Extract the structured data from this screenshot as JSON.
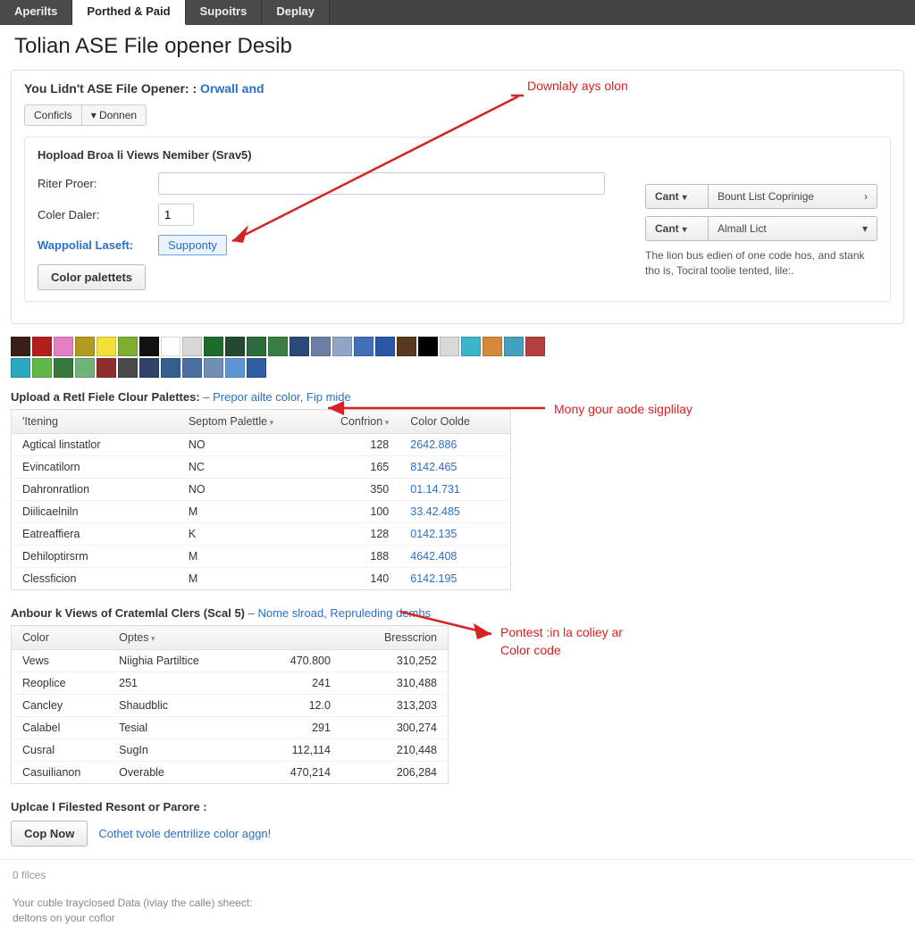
{
  "topnav": {
    "tabs": [
      "Aperilts",
      "Porthed & Paid",
      "Supoitrs",
      "Deplay"
    ],
    "active_index": 1
  },
  "page_title": "Tolian ASE File opener Desib",
  "panel1": {
    "title_prefix": "You Lidn't ASE File Opener: :",
    "title_link": "Orwall and",
    "subtabs": [
      "Conficls",
      "▾ Donnen"
    ],
    "sub_title": "Hopload Broa li Views Nemiber (Srav5)",
    "row_riter": {
      "label": "Riter Proer:",
      "value": ""
    },
    "row_coler": {
      "label": "Coler Daler:",
      "value": "1"
    },
    "row_link": {
      "label": "Wappolial Laseft:",
      "token": "Supponty"
    },
    "main_btn": "Color palettets",
    "right": {
      "pair1": {
        "left": "Cant",
        "right": "Bount List Coprinige"
      },
      "pair2": {
        "left": "Cant",
        "right": "Almall Lict"
      },
      "desc": "The lion bus edien of one code hos, and stank tho is, Tociral toolie tented, lile:."
    }
  },
  "swatches": [
    "#3b1f1a",
    "#b2201c",
    "#e381c0",
    "#b19b1c",
    "#f3e13a",
    "#7fae2f",
    "#111",
    "#fff",
    "#d8d8d8",
    "#1b6d2b",
    "#234a2f",
    "#2d6a3e",
    "#3a7d45",
    "#2b4a7a",
    "#6a7ea6",
    "#8fa6c9",
    "#4270b7",
    "#2a56a5",
    "#5a3a1d",
    "#000",
    "#d9d9d9",
    "#3bb6c9",
    "#d48a38",
    "#45a0bf",
    "#b34040",
    "#2aa8c0",
    "#5fb846",
    "#357a3c",
    "#6fb37a",
    "#8e2f2f",
    "#4a4a4a",
    "#2f446b",
    "#355d8f",
    "#4a6fa3",
    "#6f8fb8",
    "#5c97d4",
    "#2f5fa0"
  ],
  "section2": {
    "title": "Upload a Retl Fiele Clour Palettes:",
    "link": "– Prepor ailte color, Fip mide",
    "headers": [
      "'Itening",
      "Septom Palettle",
      "Confrion",
      "Color Oolde"
    ],
    "rows": [
      [
        "Agtical linstatlor",
        "NO",
        "128",
        "2642.886"
      ],
      [
        "Evincatilorn",
        "NC",
        "165",
        "8142.465"
      ],
      [
        "Dahronratlion",
        "NO",
        "350",
        "01.14.731"
      ],
      [
        "Diilicaelniln",
        "M",
        "100",
        "33.42.485"
      ],
      [
        "Eatreaffiera",
        "K",
        "128",
        "0142.135"
      ],
      [
        "Dehiloptirsrm",
        "M",
        "188",
        "4642.408"
      ],
      [
        "Clessficion",
        "M",
        "140",
        "6142.195"
      ]
    ]
  },
  "section3": {
    "title": "Anbour k Views of Cratemlal Clers (Scal 5)",
    "link": "– Nome slroad, Repruleding demhs",
    "headers": [
      "Color",
      "Optes",
      "",
      "Bresscrion"
    ],
    "rows": [
      [
        "Vews",
        "Niighia Partiltice",
        "470.800",
        "310,252"
      ],
      [
        "Reoplice",
        "251",
        "241",
        "310,488"
      ],
      [
        "Cancley",
        "Shaudblic",
        "12.0",
        "313,203"
      ],
      [
        "Calabel",
        "Tesial",
        "291",
        "300,274"
      ],
      [
        "Cusral",
        "SugIn",
        "112,114",
        "210,448"
      ],
      [
        "Casuilianon",
        "Overable",
        "470,214",
        "206,284"
      ]
    ]
  },
  "bottom": {
    "label": "Uplcae l Filested Resont or Parore :",
    "btn": "Cop Now",
    "bluetext": "Cothet tvole dentrilize color aggn!"
  },
  "footer": "0 filces",
  "footnote1": "Your cuble trayclosed Data (iviay the calle) sheect:",
  "footnote2": "deltons on your coflor",
  "annotations": {
    "a1": "Downlaly ays olon",
    "a2": "Mony gour aode sigplilay",
    "a3a": "Pontest :in la coliey ar",
    "a3b": "Color code"
  }
}
